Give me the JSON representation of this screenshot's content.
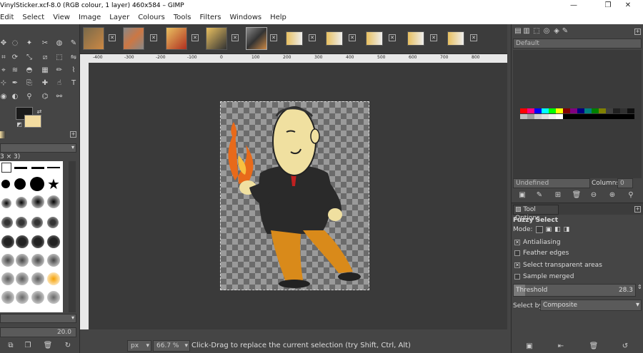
{
  "window": {
    "title": "VinylSticker.xcf-8.0 (RGB colour, 1 layer) 460x584 – GIMP",
    "minimize": "—",
    "maximize": "❐",
    "close": "✕"
  },
  "menubar": [
    "Edit",
    "Select",
    "View",
    "Image",
    "Layer",
    "Colours",
    "Tools",
    "Filters",
    "Windows",
    "Help"
  ],
  "toolbox": {
    "brush_size_label": "3 × 3)",
    "brush_size_value": "20.0"
  },
  "ruler": {
    "ticks": [
      "-400",
      "-300",
      "-200",
      "-100",
      "0",
      "100",
      "200",
      "300",
      "400",
      "500",
      "600",
      "700",
      "800"
    ]
  },
  "statusbar": {
    "unit": "px",
    "zoom": "66.7 %",
    "message": "Click-Drag to replace the current selection (try Shift, Ctrl, Alt)"
  },
  "palette": {
    "name": "Default",
    "brush_name": "Undefined",
    "columns_label": "Columns:",
    "columns_value": "0"
  },
  "tool_options": {
    "tab_label": "Tool Options",
    "tool_name": "Fuzzy Select",
    "mode_label": "Mode:",
    "antialiasing": "Antialiasing",
    "feather": "Feather edges",
    "transparent": "Select transparent areas",
    "sample_merged": "Sample merged",
    "threshold_label": "Threshold",
    "threshold_value": "28.3",
    "select_by_label": "Select by:",
    "select_by_value": "Composite"
  },
  "colors": {
    "fg": "#1b1b1b",
    "bg": "#f3dca0"
  }
}
